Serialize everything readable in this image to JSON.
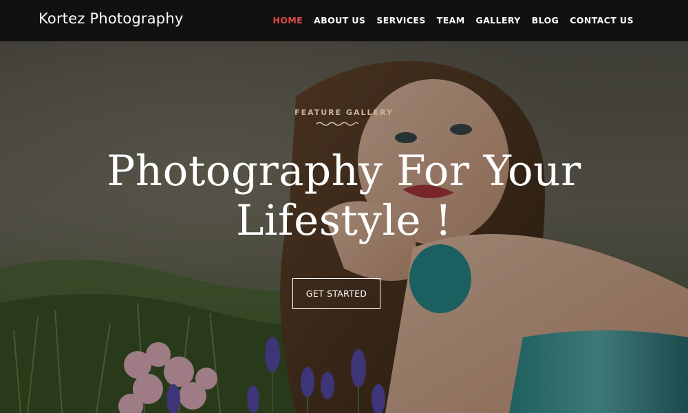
{
  "header": {
    "logo": "Kortez Photography",
    "nav": [
      {
        "label": "HOME",
        "active": true
      },
      {
        "label": "ABOUT US",
        "active": false
      },
      {
        "label": "SERVICES",
        "active": false
      },
      {
        "label": "TEAM",
        "active": false
      },
      {
        "label": "GALLERY",
        "active": false
      },
      {
        "label": "BLOG",
        "active": false
      },
      {
        "label": "CONTACT US",
        "active": false
      }
    ]
  },
  "hero": {
    "kicker": "FEATURE GALLERY",
    "headline_line1": "Photography For Your",
    "headline_line2": "Lifestyle !",
    "cta_label": "GET STARTED"
  },
  "colors": {
    "header_bg": "#111111",
    "active_nav": "#e04a4a",
    "kicker": "#c9b79a",
    "text": "#ffffff"
  }
}
